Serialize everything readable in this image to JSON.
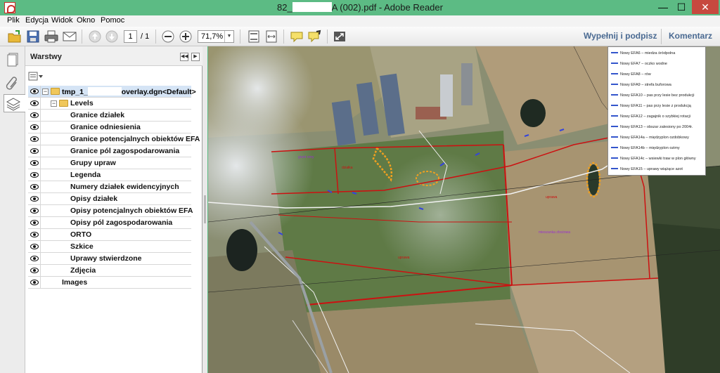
{
  "window": {
    "title_prefix": "82_",
    "title_suffix": "A (002).pdf - Adobe Reader",
    "minimize": "—",
    "maximize": "☐",
    "close": "✕"
  },
  "menu": [
    "Plik",
    "Edycja",
    "Widok",
    "Okno",
    "Pomoc"
  ],
  "toolbar": {
    "page_current": "1",
    "page_total": "/ 1",
    "zoom": "71,7%",
    "fill_sign": "Wypełnij i podpisz",
    "comment": "Komentarz"
  },
  "panel": {
    "title": "Warstwy",
    "root_prefix": "tmp_1_",
    "root_suffix": "overlay.dgn<Default>",
    "levels_label": "Levels",
    "levels": [
      "Granice działek",
      "Granice odniesienia",
      "Granice potencjalnych obiektów EFA",
      "Granice pól zagospodarowania",
      "Grupy upraw",
      "Legenda",
      "Numery działek ewidencyjnych",
      "Opisy działek",
      "Opisy potencjalnych obiektów EFA",
      "Opisy pól zagospodarowania",
      "ORTO",
      "Szkice",
      "Uprawy stwierdzone",
      "Zdjęcia"
    ],
    "images_label": "Images"
  },
  "legend": [
    "Nowy EFA6 – miedza śródpolna",
    "Nowy EFA7 – oczko wodne",
    "Nowy EFA8 – rów",
    "Nowy EFA9 – strefa buforowa",
    "Nowy EFA10 – pas przy lesie bez produkcji",
    "Nowy EFA11 – pas przy lesie z produkcją",
    "Nowy EFA12 – zagajnik o szybkiej rotacji",
    "Nowy EFA13 – obszar zalesiony po 2004r.",
    "Nowy EFA14a – międzyplon ozdobkowy",
    "Nowy EFA14b – międzyplon ozimy",
    "Nowy EFA14c – wsiewki traw w plon główny",
    "Nowy EFA15 – uprawy wiążące azot"
  ],
  "colors": {
    "title_bar": "#5cbb84",
    "accent_link": "#4a6a92",
    "parcel_boundary": "#cc1111",
    "efa_outline": "#f0a020"
  }
}
